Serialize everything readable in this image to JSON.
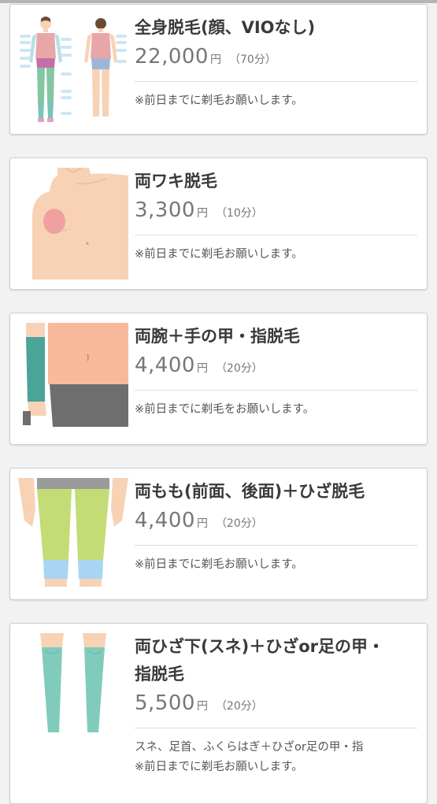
{
  "menus": [
    {
      "title": [
        "全身脱毛(顔、VIOなし)"
      ],
      "price": "22,000",
      "unit": "円",
      "duration": "（70分）",
      "notes": [
        "※前日までに剃毛お願いします。"
      ],
      "illustration": "full-body-front-back-diagram"
    },
    {
      "title": [
        "両ワキ脱毛"
      ],
      "price": "3,300",
      "unit": "円",
      "duration": "（10分）",
      "notes": [
        "※前日までに剃毛お願いします。"
      ],
      "illustration": "armpit-diagram"
    },
    {
      "title": [
        "両腕＋手の甲・指脱毛"
      ],
      "price": "4,400",
      "unit": "円",
      "duration": "（20分）",
      "notes": [
        "※前日までに剃毛をお願いします。"
      ],
      "illustration": "arm-hand-diagram"
    },
    {
      "title": [
        "両もも(前面、後面)＋ひざ脱毛"
      ],
      "price": "4,400",
      "unit": "円",
      "duration": "（20分）",
      "notes": [
        "※前日までに剃毛お願いします。"
      ],
      "illustration": "thigh-knee-diagram"
    },
    {
      "title": [
        "両ひざ下(スネ)＋ひざor足の甲・",
        "指脱毛"
      ],
      "price": "5,500",
      "unit": "円",
      "duration": "（20分）",
      "notes": [
        "スネ、足首、ふくらはぎ＋ひざor足の甲・指",
        "※前日までに剃毛お願いします。"
      ],
      "illustration": "lower-leg-diagram"
    }
  ],
  "colors": {
    "skin": "#f8d2b5",
    "armpit_highlight": "#eea1a0",
    "arm_teal": "#4aa498",
    "thigh_green": "#c3dc76",
    "knee_blue": "#a7d5f2",
    "shin_teal": "#80cbbb",
    "shorts_gray": "#6e6e6e"
  }
}
